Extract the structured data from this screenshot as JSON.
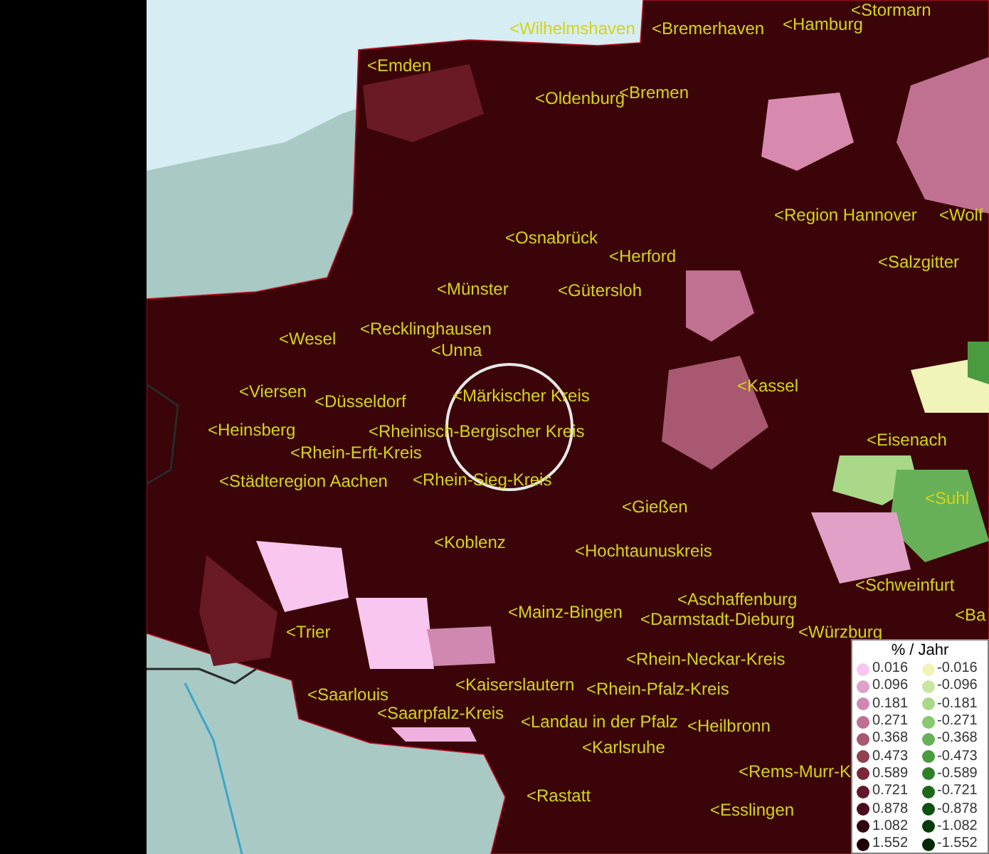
{
  "map_labels": [
    {
      "text": "<Stormarn"
    },
    {
      "text": "<Wilhelmshaven"
    },
    {
      "text": "<Bremerhaven"
    },
    {
      "text": "<Hamburg"
    },
    {
      "text": "<Emden"
    },
    {
      "text": "<Oldenburg"
    },
    {
      "text": "<Bremen"
    },
    {
      "text": "<Region Hannover"
    },
    {
      "text": "<Wolf"
    },
    {
      "text": "<Osnabrück"
    },
    {
      "text": "<Herford"
    },
    {
      "text": "<Salzgitter"
    },
    {
      "text": "<Münster"
    },
    {
      "text": "<Gütersloh"
    },
    {
      "text": "<Wesel"
    },
    {
      "text": "<Recklinghausen"
    },
    {
      "text": "<Unna"
    },
    {
      "text": "<Viersen"
    },
    {
      "text": "<Düsseldorf"
    },
    {
      "text": "<Märkischer Kreis"
    },
    {
      "text": "<Kassel"
    },
    {
      "text": "<Heinsberg"
    },
    {
      "text": "<Rheinisch-Bergischer Kreis"
    },
    {
      "text": "<Eisenach"
    },
    {
      "text": "<Rhein-Erft-Kreis"
    },
    {
      "text": "<Städteregion Aachen"
    },
    {
      "text": "<Rhein-Sieg-Kreis"
    },
    {
      "text": "<Suhl"
    },
    {
      "text": "<Gießen"
    },
    {
      "text": "<Koblenz"
    },
    {
      "text": "<Hochtaunuskreis"
    },
    {
      "text": "<Schweinfurt"
    },
    {
      "text": "<Aschaffenburg"
    },
    {
      "text": "<Mainz-Bingen"
    },
    {
      "text": "<Darmstadt-Dieburg"
    },
    {
      "text": "<Würzburg"
    },
    {
      "text": "<Ba"
    },
    {
      "text": "<Trier"
    },
    {
      "text": "<Rhein-Neckar-Kreis"
    },
    {
      "text": "<Saarlouis"
    },
    {
      "text": "<Kaiserslautern"
    },
    {
      "text": "<Rhein-Pfalz-Kreis"
    },
    {
      "text": "<Saarpfalz-Kreis"
    },
    {
      "text": "<Landau in der Pfalz"
    },
    {
      "text": "<Heilbronn"
    },
    {
      "text": "<Karlsruhe"
    },
    {
      "text": "<Rems-Murr-K"
    },
    {
      "text": "<Rastatt"
    },
    {
      "text": "<Esslingen"
    }
  ],
  "legend": {
    "title": "% / Jahr",
    "positive": [
      {
        "value": "0.016",
        "color": "#f8c6ee"
      },
      {
        "value": "0.096",
        "color": "#e0a0c8"
      },
      {
        "value": "0.181",
        "color": "#d088b0"
      },
      {
        "value": "0.271",
        "color": "#c07090"
      },
      {
        "value": "0.368",
        "color": "#a85870"
      },
      {
        "value": "0.473",
        "color": "#904050"
      },
      {
        "value": "0.589",
        "color": "#7a2838"
      },
      {
        "value": "0.721",
        "color": "#62182a"
      },
      {
        "value": "0.878",
        "color": "#4a0c1c"
      },
      {
        "value": "1.082",
        "color": "#320610"
      },
      {
        "value": "1.552",
        "color": "#200008"
      }
    ],
    "negative": [
      {
        "value": "-0.016",
        "color": "#f0f4b8"
      },
      {
        "value": "-0.096",
        "color": "#c8e6a0"
      },
      {
        "value": "-0.181",
        "color": "#a8d888"
      },
      {
        "value": "-0.271",
        "color": "#88c870"
      },
      {
        "value": "-0.368",
        "color": "#68b058"
      },
      {
        "value": "-0.473",
        "color": "#4a9a40"
      },
      {
        "value": "-0.589",
        "color": "#2e8028"
      },
      {
        "value": "-0.721",
        "color": "#1c6818"
      },
      {
        "value": "-0.878",
        "color": "#0e5010"
      },
      {
        "value": "-1.082",
        "color": "#063a08"
      },
      {
        "value": "-1.552",
        "color": "#022a04"
      }
    ]
  }
}
